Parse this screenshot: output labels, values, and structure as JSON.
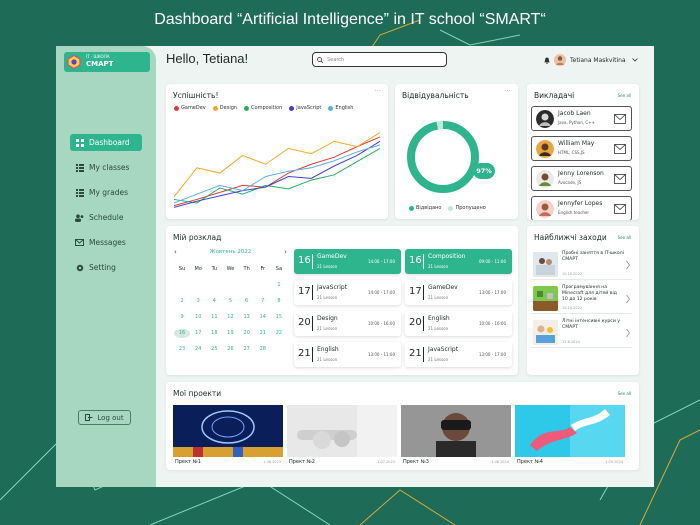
{
  "page_title": "Dashboard “Artificial Intelligence” in IT school “SMART“",
  "colors": {
    "background": "#1e6b58",
    "accent": "#2fb58e",
    "sidebar": "#a7d7c0",
    "app_bg": "#eef4f1"
  },
  "logo": {
    "small": "IT · ШКОЛА",
    "big": "СМАРТ"
  },
  "header": {
    "greeting": "Hello, Tetiana!",
    "search_placeholder": "Search",
    "user_name": "Tetiana Maskvitina"
  },
  "sidebar": {
    "items": [
      {
        "label": "Dashboard",
        "icon": "grid-icon",
        "active": true
      },
      {
        "label": "My classes",
        "icon": "list-icon",
        "active": false
      },
      {
        "label": "My grades",
        "icon": "list-icon",
        "active": false
      },
      {
        "label": "Schedule",
        "icon": "users-icon",
        "active": false
      },
      {
        "label": "Messages",
        "icon": "mail-icon",
        "active": false
      },
      {
        "label": "Setting",
        "icon": "gear-icon",
        "active": false
      }
    ],
    "logout": "Log out"
  },
  "performance": {
    "title": "Успішність!",
    "more": "···",
    "chart_data": {
      "type": "line",
      "ylim": [
        0,
        100
      ],
      "x": [
        0,
        1,
        2,
        3,
        4,
        5,
        6,
        7,
        8,
        9
      ],
      "series": [
        {
          "name": "GameDev",
          "color": "#e53935",
          "values": [
            5,
            12,
            20,
            28,
            26,
            42,
            52,
            60,
            72,
            83
          ]
        },
        {
          "name": "Design",
          "color": "#f5a623",
          "values": [
            15,
            48,
            42,
            62,
            52,
            70,
            64,
            78,
            72,
            88
          ]
        },
        {
          "name": "Composition",
          "color": "#27ae60",
          "values": [
            12,
            8,
            25,
            18,
            28,
            24,
            34,
            40,
            55,
            70
          ]
        },
        {
          "name": "JavaScript",
          "color": "#3f3fd0",
          "values": [
            3,
            10,
            16,
            22,
            26,
            38,
            36,
            50,
            62,
            78
          ]
        },
        {
          "name": "English",
          "color": "#5dade2",
          "values": [
            8,
            18,
            28,
            22,
            38,
            44,
            48,
            56,
            66,
            74
          ]
        }
      ]
    }
  },
  "attendance": {
    "title": "Відвідувальність",
    "more": "···",
    "percent_label": "97%",
    "chart_data": {
      "type": "pie",
      "categories": [
        "Відвідано",
        "Пропущено"
      ],
      "values": [
        97,
        3
      ],
      "colors": [
        "#2fb58e",
        "#bfe8d6"
      ]
    }
  },
  "teachers": {
    "title": "Викладачі",
    "see_all": "See all",
    "items": [
      {
        "name": "Jacob Laen",
        "subject": "Java, Python, C++"
      },
      {
        "name": "William May",
        "subject": "HTML, CSS,JS"
      },
      {
        "name": "Jenny Lorenson",
        "subject": "Avocade, JS"
      },
      {
        "name": "Jennyfer Lopes",
        "subject": "English teacher"
      }
    ]
  },
  "events": {
    "title": "Найближчі заходи",
    "see_all": "See all",
    "items": [
      {
        "title": "Пробні заняття в IT-школі СМАРТ",
        "date": "10.10.2022"
      },
      {
        "title": "Програмування на Minecraft для дітей від 10 до 12 років",
        "date": "10.10.2022"
      },
      {
        "title": "Літні інтенсивні курси у СМАРТ",
        "date": "12.6.2024"
      }
    ]
  },
  "schedule": {
    "title": "Мій розклад",
    "calendar": {
      "month": "Жовтень 2022",
      "prev": "‹",
      "next": "›",
      "weekdays": [
        "Su",
        "Mo",
        "Tu",
        "We",
        "Th",
        "Fr",
        "Sa"
      ],
      "days": [
        "",
        "",
        "",
        "",
        "",
        "",
        "1",
        "2",
        "3",
        "4",
        "5",
        "6",
        "7",
        "8",
        "9",
        "10",
        "11",
        "12",
        "13",
        "14",
        "15",
        "16",
        "17",
        "18",
        "19",
        "20",
        "21",
        "22",
        "23",
        "24",
        "25",
        "26",
        "27",
        "28",
        "",
        "",
        "",
        "",
        ""
      ],
      "today": "16"
    },
    "lessons": [
      {
        "day": "16",
        "subject": "GameDev",
        "lesson": "21 Lesson",
        "time": "14:00 - 17:00",
        "highlight": true
      },
      {
        "day": "16",
        "subject": "Composition",
        "lesson": "21 Lesson",
        "time": "09:00 - 11:00",
        "highlight": true
      },
      {
        "day": "17",
        "subject": "JavaScript",
        "lesson": "21 Lesson",
        "time": "14:00 - 17:00",
        "highlight": false
      },
      {
        "day": "17",
        "subject": "GameDev",
        "lesson": "21 Lesson",
        "time": "13:00 - 17:00",
        "highlight": false
      },
      {
        "day": "20",
        "subject": "Design",
        "lesson": "21 Lesson",
        "time": "10:00 - 16:00",
        "highlight": false
      },
      {
        "day": "20",
        "subject": "English",
        "lesson": "21 Lesson",
        "time": "10:00 - 16:00",
        "highlight": false
      },
      {
        "day": "21",
        "subject": "English",
        "lesson": "21 Lesson",
        "time": "13:00 - 11:00",
        "highlight": false
      },
      {
        "day": "21",
        "subject": "JavaScript",
        "lesson": "21 Lesson",
        "time": "13:00 - 17:00",
        "highlight": false
      }
    ]
  },
  "projects": {
    "title": "Мої проекти",
    "see_all": "See all",
    "items": [
      {
        "name": "Прект №1",
        "date": "1.06.2023"
      },
      {
        "name": "Прект №2",
        "date": "1.07.2023"
      },
      {
        "name": "Прект №3",
        "date": "1.08.2024"
      },
      {
        "name": "Прект №4",
        "date": "1.09.2024"
      }
    ]
  }
}
